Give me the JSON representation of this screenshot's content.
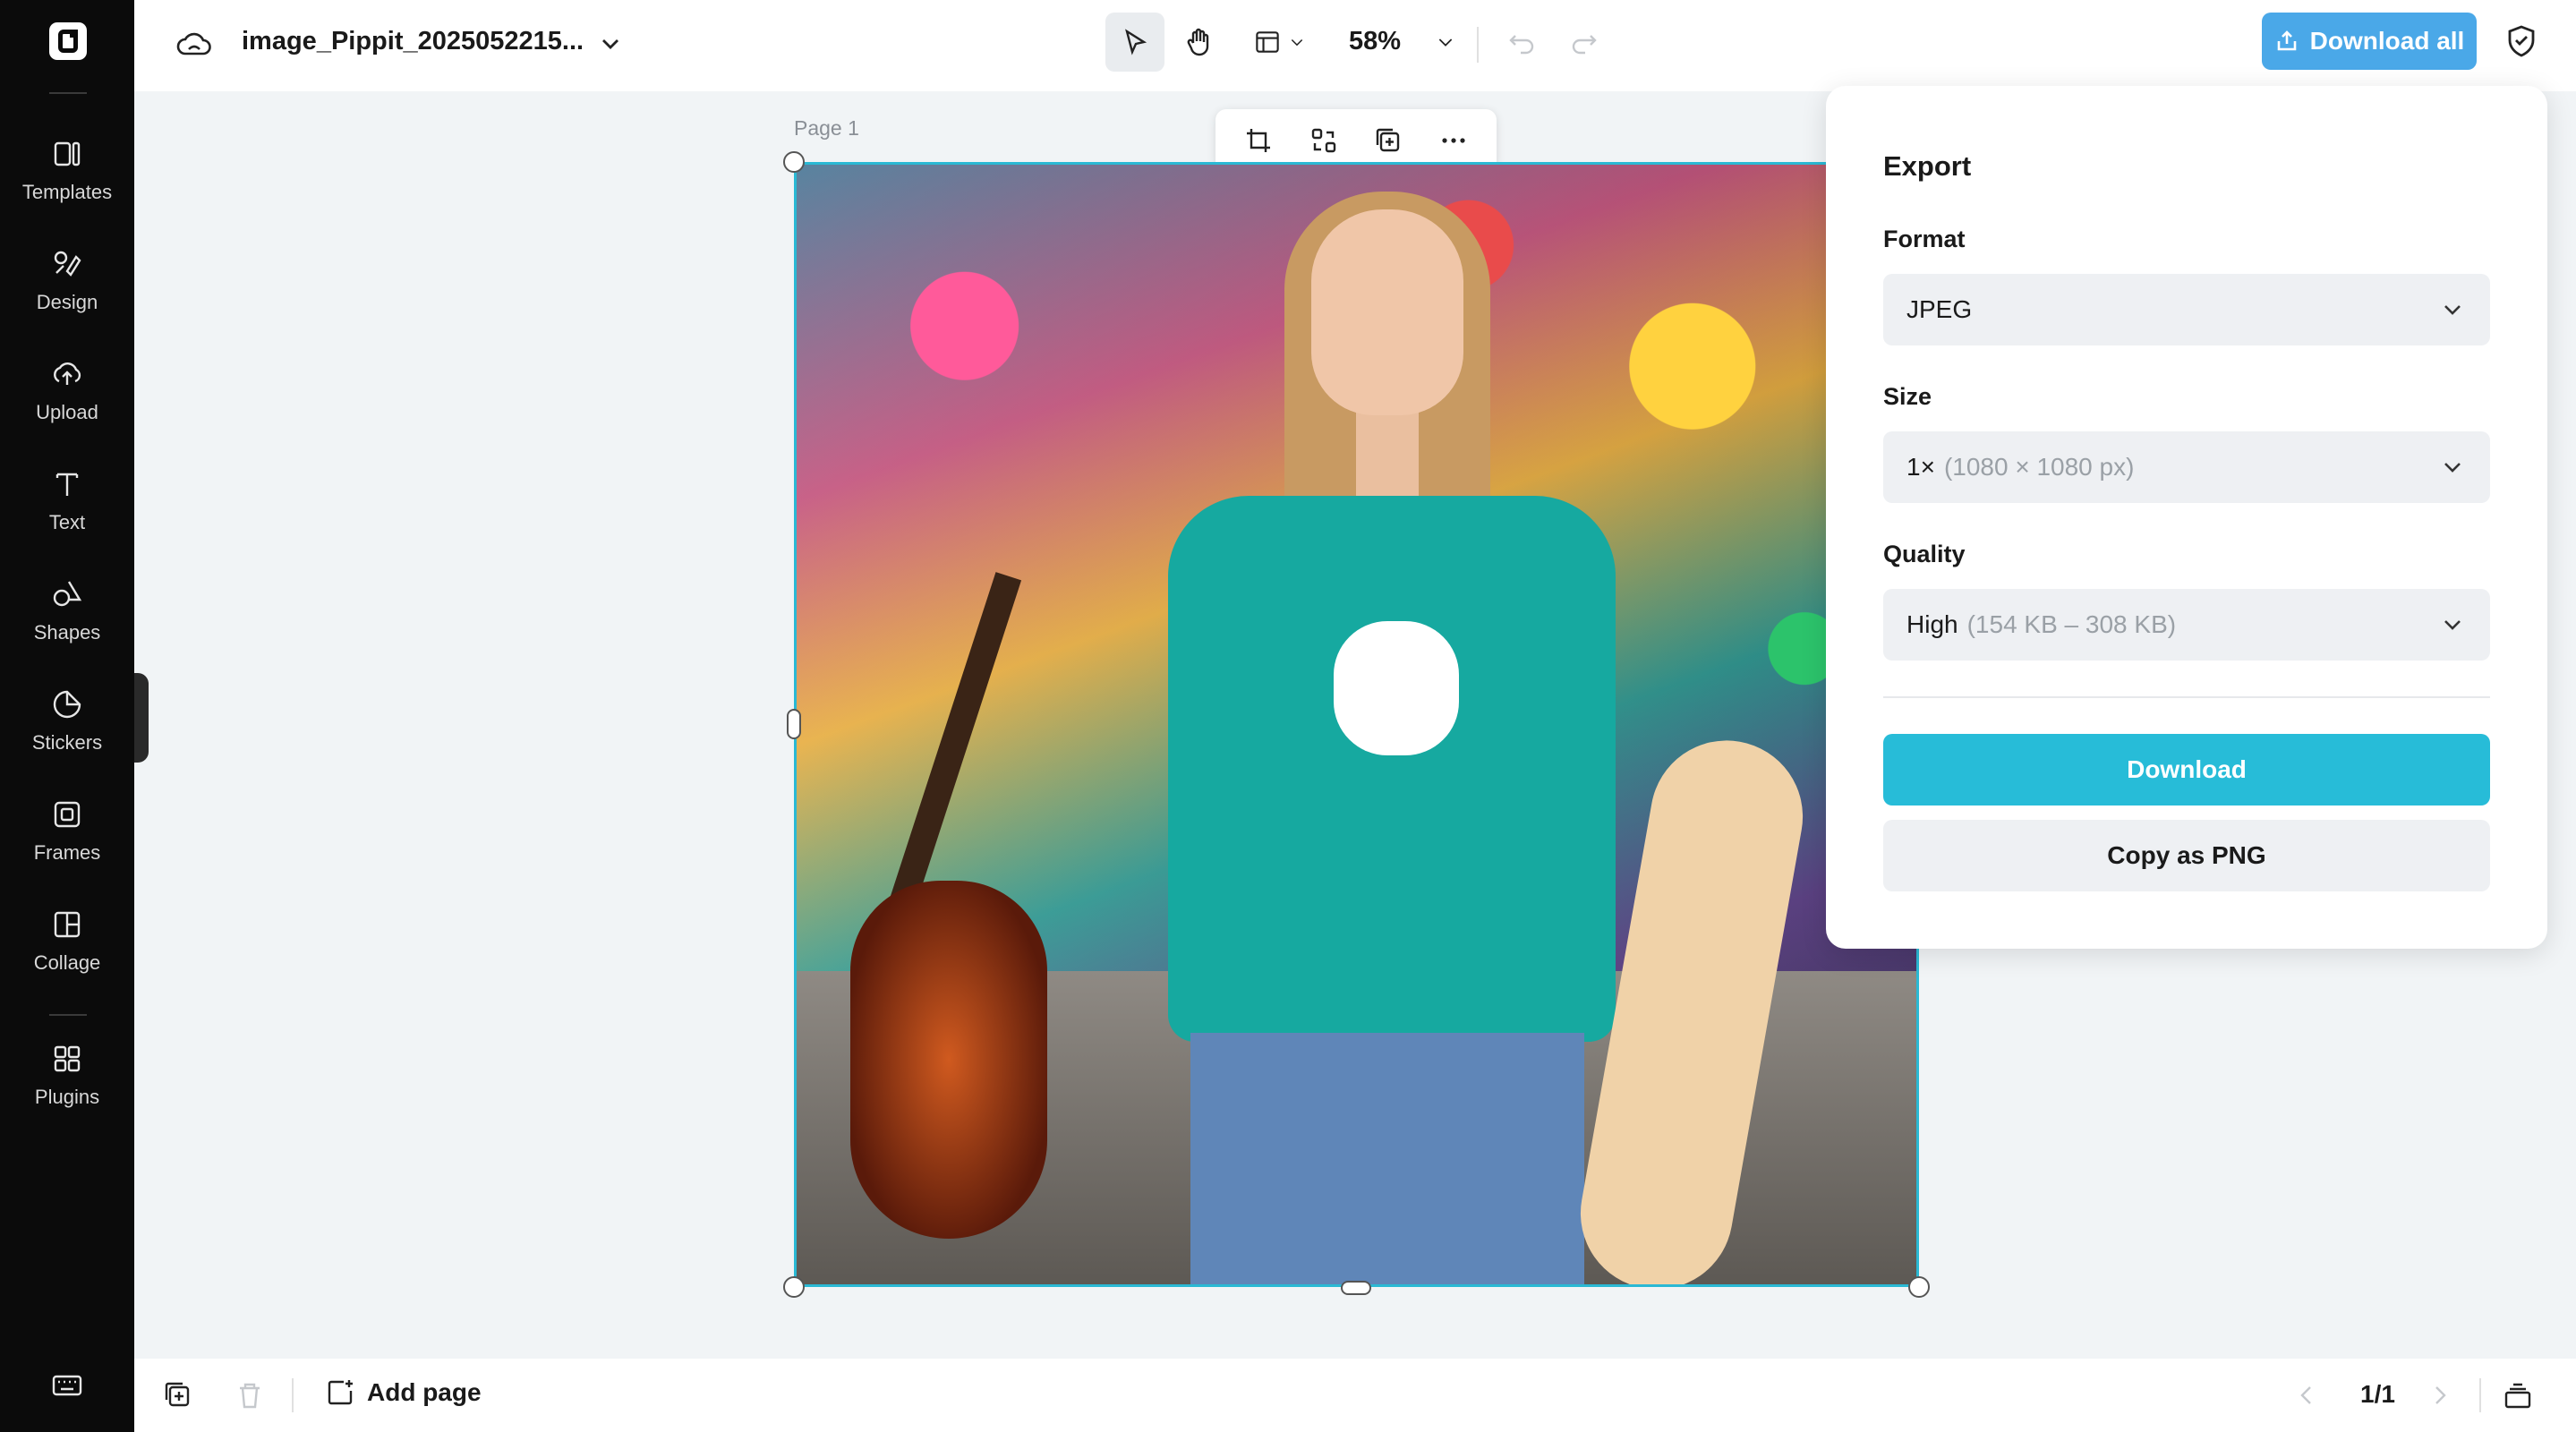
{
  "sidebar": {
    "items": [
      {
        "label": "Templates",
        "icon": "templates-icon"
      },
      {
        "label": "Design",
        "icon": "design-icon"
      },
      {
        "label": "Upload",
        "icon": "upload-icon"
      },
      {
        "label": "Text",
        "icon": "text-icon"
      },
      {
        "label": "Shapes",
        "icon": "shapes-icon"
      },
      {
        "label": "Stickers",
        "icon": "stickers-icon"
      },
      {
        "label": "Frames",
        "icon": "frames-icon"
      },
      {
        "label": "Collage",
        "icon": "collage-icon"
      },
      {
        "label": "Plugins",
        "icon": "plugins-icon"
      }
    ]
  },
  "topbar": {
    "filename": "image_Pippit_2025052215...",
    "zoom": "58%",
    "download_all": "Download all"
  },
  "canvas": {
    "page_label": "Page 1"
  },
  "export": {
    "title": "Export",
    "format_label": "Format",
    "format_value": "JPEG",
    "size_label": "Size",
    "size_value": "1×",
    "size_detail": "(1080 × 1080 px)",
    "quality_label": "Quality",
    "quality_value": "High",
    "quality_detail": "(154 KB – 308 KB)",
    "download": "Download",
    "copy_png": "Copy as PNG"
  },
  "bottombar": {
    "add_page": "Add page",
    "pager": "1/1"
  },
  "colors": {
    "accent": "#27bcd8",
    "download_all": "#4aa8e8",
    "sidebar_bg": "#0b0b0b"
  }
}
